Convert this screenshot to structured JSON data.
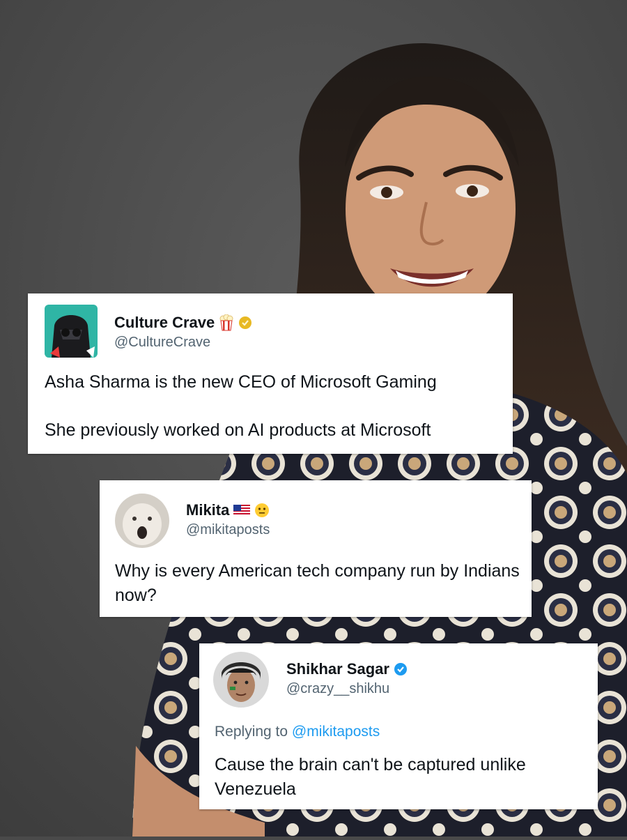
{
  "background": {
    "color": "#4a4a4a",
    "subject": "photo-portrait"
  },
  "tweets": [
    {
      "name": "Culture Crave",
      "handle": "@CultureCrave",
      "name_emoji": "popcorn-icon",
      "badge": "gold-verified-badge",
      "lines": [
        "Asha Sharma is the new CEO of Microsoft Gaming",
        "She previously worked on AI products at Microsoft"
      ]
    },
    {
      "name": "Mikita",
      "handle": "@mikitaposts",
      "name_emoji": [
        "us-flag-icon",
        "neutral-face-icon"
      ],
      "text": "Why is every American tech company run by Indians now?"
    },
    {
      "name": "Shikhar Sagar",
      "handle": "@crazy__shikhu",
      "badge": "blue-verified-badge",
      "reply_prefix": "Replying to",
      "reply_target": "@mikitaposts",
      "text": "Cause the brain can't be captured unlike Venezuela"
    }
  ],
  "colors": {
    "link": "#1d9bf0",
    "secondary_text": "#536471",
    "primary_text": "#0f1419",
    "verified_blue": "#1d9bf0",
    "verified_gold": "#e8b923"
  }
}
